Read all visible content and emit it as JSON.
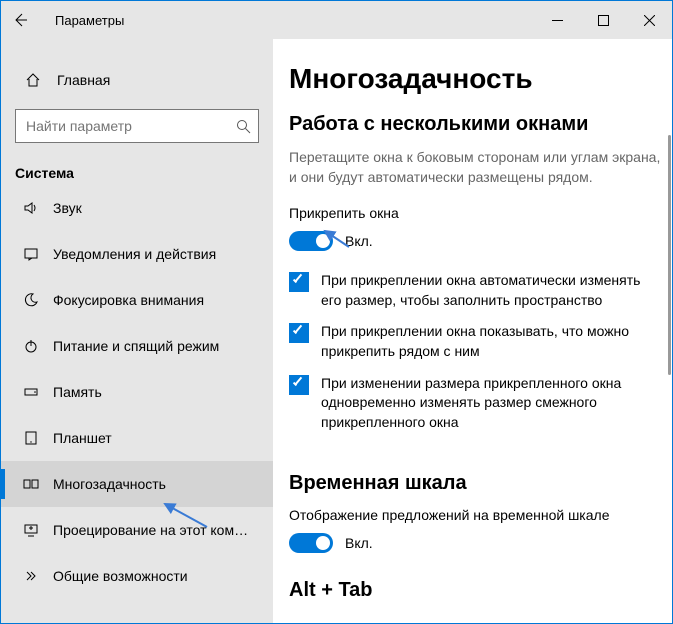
{
  "window": {
    "title": "Параметры"
  },
  "sidebar": {
    "home": "Главная",
    "search_placeholder": "Найти параметр",
    "section": "Система",
    "items": [
      {
        "label": "Звук"
      },
      {
        "label": "Уведомления и действия"
      },
      {
        "label": "Фокусировка внимания"
      },
      {
        "label": "Питание и спящий режим"
      },
      {
        "label": "Память"
      },
      {
        "label": "Планшет"
      },
      {
        "label": "Многозадачность"
      },
      {
        "label": "Проецирование на этот компьютер"
      },
      {
        "label": "Общие возможности"
      }
    ],
    "selected_index": 6
  },
  "main": {
    "title": "Многозадачность",
    "snap": {
      "heading": "Работа с несколькими окнами",
      "description": "Перетащите окна к боковым сторонам или углам экрана, и они будут автоматически размещены рядом.",
      "toggle_label": "Прикрепить окна",
      "toggle_state": "Вкл.",
      "options": [
        "При прикреплении окна автоматически изменять его размер, чтобы заполнить пространство",
        "При прикреплении окна показывать, что можно прикрепить рядом с ним",
        "При изменении размера прикрепленного окна одновременно изменять размер смежного прикрепленного окна"
      ]
    },
    "timeline": {
      "heading": "Временная шкала",
      "label": "Отображение предложений на временной шкале",
      "toggle_state": "Вкл."
    },
    "alt_tab_partial": "Alt + Tab"
  }
}
